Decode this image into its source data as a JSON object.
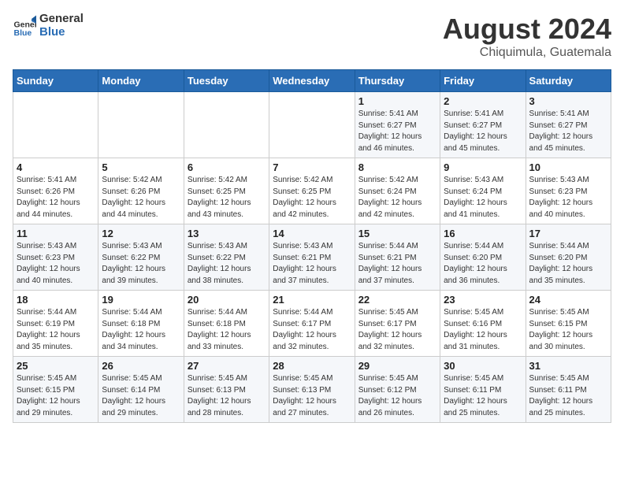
{
  "header": {
    "logo_general": "General",
    "logo_blue": "Blue",
    "title": "August 2024",
    "subtitle": "Chiquimula, Guatemala"
  },
  "days_of_week": [
    "Sunday",
    "Monday",
    "Tuesday",
    "Wednesday",
    "Thursday",
    "Friday",
    "Saturday"
  ],
  "weeks": [
    [
      {
        "day": "",
        "sunrise": "",
        "sunset": "",
        "daylight": ""
      },
      {
        "day": "",
        "sunrise": "",
        "sunset": "",
        "daylight": ""
      },
      {
        "day": "",
        "sunrise": "",
        "sunset": "",
        "daylight": ""
      },
      {
        "day": "",
        "sunrise": "",
        "sunset": "",
        "daylight": ""
      },
      {
        "day": "1",
        "sunrise": "Sunrise: 5:41 AM",
        "sunset": "Sunset: 6:27 PM",
        "daylight": "Daylight: 12 hours and 46 minutes."
      },
      {
        "day": "2",
        "sunrise": "Sunrise: 5:41 AM",
        "sunset": "Sunset: 6:27 PM",
        "daylight": "Daylight: 12 hours and 45 minutes."
      },
      {
        "day": "3",
        "sunrise": "Sunrise: 5:41 AM",
        "sunset": "Sunset: 6:27 PM",
        "daylight": "Daylight: 12 hours and 45 minutes."
      }
    ],
    [
      {
        "day": "4",
        "sunrise": "Sunrise: 5:41 AM",
        "sunset": "Sunset: 6:26 PM",
        "daylight": "Daylight: 12 hours and 44 minutes."
      },
      {
        "day": "5",
        "sunrise": "Sunrise: 5:42 AM",
        "sunset": "Sunset: 6:26 PM",
        "daylight": "Daylight: 12 hours and 44 minutes."
      },
      {
        "day": "6",
        "sunrise": "Sunrise: 5:42 AM",
        "sunset": "Sunset: 6:25 PM",
        "daylight": "Daylight: 12 hours and 43 minutes."
      },
      {
        "day": "7",
        "sunrise": "Sunrise: 5:42 AM",
        "sunset": "Sunset: 6:25 PM",
        "daylight": "Daylight: 12 hours and 42 minutes."
      },
      {
        "day": "8",
        "sunrise": "Sunrise: 5:42 AM",
        "sunset": "Sunset: 6:24 PM",
        "daylight": "Daylight: 12 hours and 42 minutes."
      },
      {
        "day": "9",
        "sunrise": "Sunrise: 5:43 AM",
        "sunset": "Sunset: 6:24 PM",
        "daylight": "Daylight: 12 hours and 41 minutes."
      },
      {
        "day": "10",
        "sunrise": "Sunrise: 5:43 AM",
        "sunset": "Sunset: 6:23 PM",
        "daylight": "Daylight: 12 hours and 40 minutes."
      }
    ],
    [
      {
        "day": "11",
        "sunrise": "Sunrise: 5:43 AM",
        "sunset": "Sunset: 6:23 PM",
        "daylight": "Daylight: 12 hours and 40 minutes."
      },
      {
        "day": "12",
        "sunrise": "Sunrise: 5:43 AM",
        "sunset": "Sunset: 6:22 PM",
        "daylight": "Daylight: 12 hours and 39 minutes."
      },
      {
        "day": "13",
        "sunrise": "Sunrise: 5:43 AM",
        "sunset": "Sunset: 6:22 PM",
        "daylight": "Daylight: 12 hours and 38 minutes."
      },
      {
        "day": "14",
        "sunrise": "Sunrise: 5:43 AM",
        "sunset": "Sunset: 6:21 PM",
        "daylight": "Daylight: 12 hours and 37 minutes."
      },
      {
        "day": "15",
        "sunrise": "Sunrise: 5:44 AM",
        "sunset": "Sunset: 6:21 PM",
        "daylight": "Daylight: 12 hours and 37 minutes."
      },
      {
        "day": "16",
        "sunrise": "Sunrise: 5:44 AM",
        "sunset": "Sunset: 6:20 PM",
        "daylight": "Daylight: 12 hours and 36 minutes."
      },
      {
        "day": "17",
        "sunrise": "Sunrise: 5:44 AM",
        "sunset": "Sunset: 6:20 PM",
        "daylight": "Daylight: 12 hours and 35 minutes."
      }
    ],
    [
      {
        "day": "18",
        "sunrise": "Sunrise: 5:44 AM",
        "sunset": "Sunset: 6:19 PM",
        "daylight": "Daylight: 12 hours and 35 minutes."
      },
      {
        "day": "19",
        "sunrise": "Sunrise: 5:44 AM",
        "sunset": "Sunset: 6:18 PM",
        "daylight": "Daylight: 12 hours and 34 minutes."
      },
      {
        "day": "20",
        "sunrise": "Sunrise: 5:44 AM",
        "sunset": "Sunset: 6:18 PM",
        "daylight": "Daylight: 12 hours and 33 minutes."
      },
      {
        "day": "21",
        "sunrise": "Sunrise: 5:44 AM",
        "sunset": "Sunset: 6:17 PM",
        "daylight": "Daylight: 12 hours and 32 minutes."
      },
      {
        "day": "22",
        "sunrise": "Sunrise: 5:45 AM",
        "sunset": "Sunset: 6:17 PM",
        "daylight": "Daylight: 12 hours and 32 minutes."
      },
      {
        "day": "23",
        "sunrise": "Sunrise: 5:45 AM",
        "sunset": "Sunset: 6:16 PM",
        "daylight": "Daylight: 12 hours and 31 minutes."
      },
      {
        "day": "24",
        "sunrise": "Sunrise: 5:45 AM",
        "sunset": "Sunset: 6:15 PM",
        "daylight": "Daylight: 12 hours and 30 minutes."
      }
    ],
    [
      {
        "day": "25",
        "sunrise": "Sunrise: 5:45 AM",
        "sunset": "Sunset: 6:15 PM",
        "daylight": "Daylight: 12 hours and 29 minutes."
      },
      {
        "day": "26",
        "sunrise": "Sunrise: 5:45 AM",
        "sunset": "Sunset: 6:14 PM",
        "daylight": "Daylight: 12 hours and 29 minutes."
      },
      {
        "day": "27",
        "sunrise": "Sunrise: 5:45 AM",
        "sunset": "Sunset: 6:13 PM",
        "daylight": "Daylight: 12 hours and 28 minutes."
      },
      {
        "day": "28",
        "sunrise": "Sunrise: 5:45 AM",
        "sunset": "Sunset: 6:13 PM",
        "daylight": "Daylight: 12 hours and 27 minutes."
      },
      {
        "day": "29",
        "sunrise": "Sunrise: 5:45 AM",
        "sunset": "Sunset: 6:12 PM",
        "daylight": "Daylight: 12 hours and 26 minutes."
      },
      {
        "day": "30",
        "sunrise": "Sunrise: 5:45 AM",
        "sunset": "Sunset: 6:11 PM",
        "daylight": "Daylight: 12 hours and 25 minutes."
      },
      {
        "day": "31",
        "sunrise": "Sunrise: 5:45 AM",
        "sunset": "Sunset: 6:11 PM",
        "daylight": "Daylight: 12 hours and 25 minutes."
      }
    ]
  ]
}
